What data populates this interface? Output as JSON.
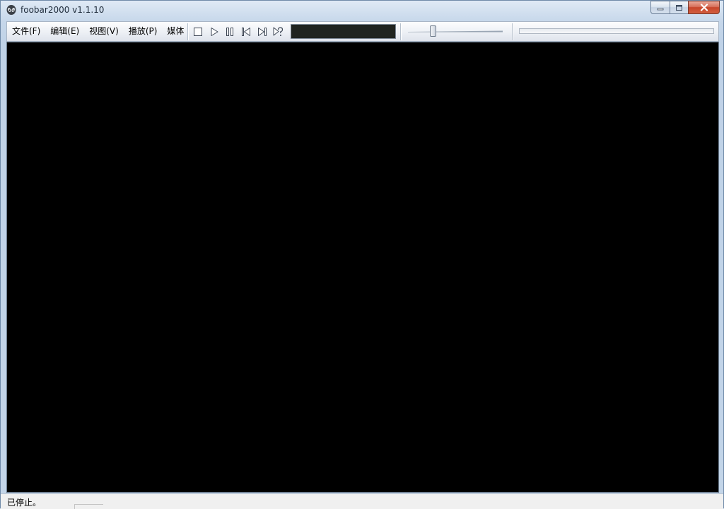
{
  "window": {
    "title": "foobar2000 v1.1.10"
  },
  "menu": {
    "items": [
      {
        "label": "文件(F)"
      },
      {
        "label": "编辑(E)"
      },
      {
        "label": "视图(V)"
      },
      {
        "label": "播放(P)"
      },
      {
        "label": "媒体"
      }
    ]
  },
  "controls": {
    "icons": [
      "stop-icon",
      "play-icon",
      "pause-icon",
      "previous-icon",
      "next-icon",
      "random-icon"
    ]
  },
  "volume": {
    "level": 0.25
  },
  "seek": {
    "position": 0
  },
  "status": {
    "text": "已停止。"
  },
  "colors": {
    "main_background": "#000000",
    "visualization_background": "#202420",
    "close_button": "#c7452b"
  }
}
